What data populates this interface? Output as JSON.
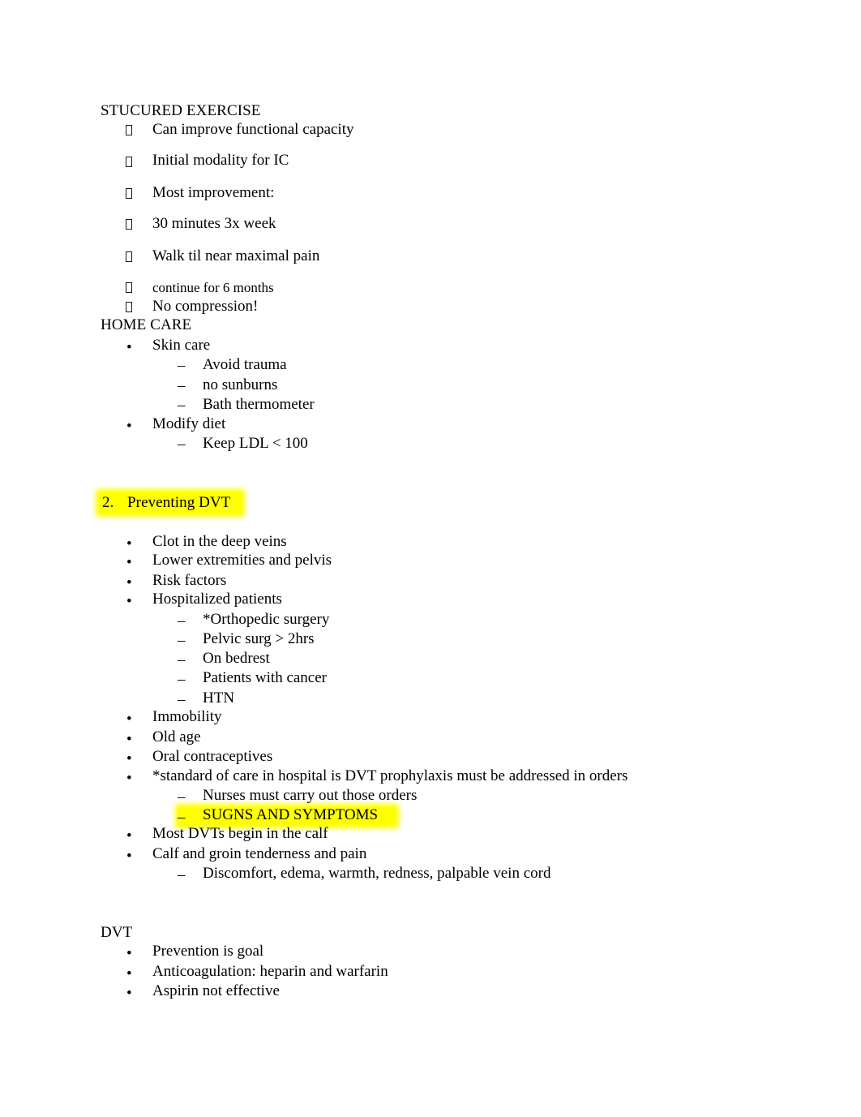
{
  "document": {
    "title": "Nursing Notes — Structured Exercise / Preventing DVT",
    "background_color": "#ffffff",
    "text_color": "#000000",
    "highlight_color": "#ffff00"
  },
  "sections": [
    {
      "id": "structured-exercise",
      "heading": "STUCURED EXERCISE",
      "bullet_glyph": "missing-glyph-box",
      "items": [
        "Can improve functional capacity",
        "Initial modality for IC",
        "Most improvement:",
        "30 minutes 3x week",
        "Walk til near maximal pain",
        "continue for 6 months",
        "No compression!"
      ]
    },
    {
      "id": "home-care",
      "heading": "HOME CARE",
      "items": [
        {
          "text": "Skin care",
          "marker": "•",
          "children": [
            {
              "text": "Avoid trauma",
              "marker": "–"
            },
            {
              "text": "no sunburns",
              "marker": "–"
            },
            {
              "text": "Bath thermometer",
              "marker": "–"
            }
          ]
        },
        {
          "text": "Modify diet",
          "marker": "•",
          "children": [
            {
              "text": "Keep LDL < 100",
              "marker": "–"
            }
          ]
        }
      ]
    },
    {
      "id": "preventing-dvt",
      "numbered_heading": {
        "number": "2.",
        "text": "Preventing DVT",
        "highlighted": true
      },
      "items": [
        {
          "text": "Clot in the deep veins",
          "marker": "•"
        },
        {
          "text": "Lower extremities and pelvis",
          "marker": "•"
        },
        {
          "text": "Risk factors",
          "marker": "•"
        },
        {
          "text": "Hospitalized patients",
          "marker": "•",
          "children": [
            {
              "text": "*Orthopedic surgery",
              "marker": "–"
            },
            {
              "text": "Pelvic surg > 2hrs",
              "marker": "–"
            },
            {
              "text": "On bedrest",
              "marker": "–"
            },
            {
              "text": "Patients with cancer",
              "marker": "–"
            },
            {
              "text": "HTN",
              "marker": "–"
            }
          ]
        },
        {
          "text": "Immobility",
          "marker": "•"
        },
        {
          "text": "Old age",
          "marker": "•"
        },
        {
          "text": "Oral contraceptives",
          "marker": "•"
        },
        {
          "text": "*standard of care in hospital is DVT prophylaxis must be addressed in orders",
          "marker": "•",
          "children": [
            {
              "text": "Nurses must carry out those orders",
              "marker": "–"
            },
            {
              "text": "SUGNS AND SYMPTOMS",
              "marker": "–",
              "highlighted": true
            }
          ]
        },
        {
          "text": "Most DVTs begin in the calf",
          "marker": "•"
        },
        {
          "text": "Calf and groin tenderness and pain",
          "marker": "•",
          "children": [
            {
              "text": "Discomfort, edema, warmth, redness, palpable vein cord",
              "marker": "–"
            }
          ]
        }
      ]
    },
    {
      "id": "dvt",
      "heading": "DVT",
      "items": [
        {
          "text": "Prevention is goal",
          "marker": "•"
        },
        {
          "text": "Anticoagulation: heparin and warfarin",
          "marker": "•"
        },
        {
          "text": "Aspirin not effective",
          "marker": "•"
        }
      ]
    }
  ],
  "markers": {
    "dot": "•",
    "dash": "–",
    "number_two": "2."
  }
}
